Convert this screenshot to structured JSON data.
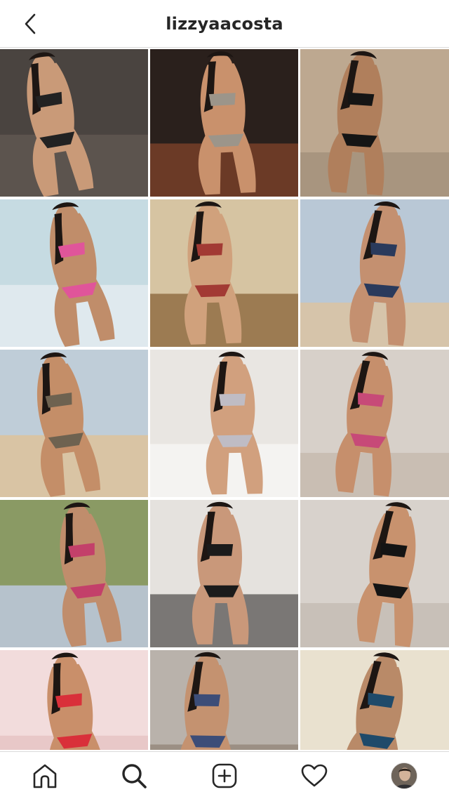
{
  "header": {
    "username": "lizzyaacosta",
    "back_icon": "chevron-left-icon"
  },
  "grid": {
    "columns": 3,
    "tiles": [
      {
        "name": "post-tile-1",
        "bg": "#4a4440",
        "ground": "#5c544e",
        "figure": "#c99a78",
        "accent": "#222222"
      },
      {
        "name": "post-tile-2",
        "bg": "#2a201c",
        "ground": "#6b3a26",
        "figure": "#c9916c",
        "accent": "#9c958a"
      },
      {
        "name": "post-tile-3",
        "bg": "#bda890",
        "ground": "#a8957f",
        "figure": "#b07f5c",
        "accent": "#151515"
      },
      {
        "name": "post-tile-4",
        "bg": "#c6dbe2",
        "ground": "#dfe9ee",
        "figure": "#c08d6a",
        "accent": "#e0559a"
      },
      {
        "name": "post-tile-5",
        "bg": "#d6c4a2",
        "ground": "#9c7b52",
        "figure": "#d0a17c",
        "accent": "#a23a34"
      },
      {
        "name": "post-tile-6",
        "bg": "#b9c8d6",
        "ground": "#d6c4aa",
        "figure": "#c49070",
        "accent": "#2a3a5c"
      },
      {
        "name": "post-tile-7",
        "bg": "#bfcdd8",
        "ground": "#d9c4a4",
        "figure": "#c48e68",
        "accent": "#6e6250"
      },
      {
        "name": "post-tile-8",
        "bg": "#e9e6e2",
        "ground": "#f4f3f1",
        "figure": "#d1a07e",
        "accent": "#bfbcc4"
      },
      {
        "name": "post-tile-9",
        "bg": "#d7d0c9",
        "ground": "#c9beb3",
        "figure": "#c68f6c",
        "accent": "#c74a78"
      },
      {
        "name": "post-tile-10",
        "bg": "#8a9a64",
        "ground": "#b6c2cc",
        "figure": "#c08d6c",
        "accent": "#c3406a"
      },
      {
        "name": "post-tile-11",
        "bg": "#e5e2de",
        "ground": "#7a7775",
        "figure": "#c9987a",
        "accent": "#1b1b1b"
      },
      {
        "name": "post-tile-12",
        "bg": "#d8d2cc",
        "ground": "#c8c0b8",
        "figure": "#c8926e",
        "accent": "#141414"
      },
      {
        "name": "post-tile-13",
        "bg": "#f2dcdc",
        "ground": "#e8c8c8",
        "figure": "#c98f6a",
        "accent": "#d9303a"
      },
      {
        "name": "post-tile-14",
        "bg": "#b9b2ab",
        "ground": "#9b8f84",
        "figure": "#c49270",
        "accent": "#3c4d78"
      },
      {
        "name": "post-tile-15",
        "bg": "#e9e1cf",
        "ground": "#d9cdb4",
        "figure": "#b98a68",
        "accent": "#1f4a6a"
      }
    ]
  },
  "tabbar": {
    "items": [
      {
        "name": "tab-home",
        "icon": "home-icon"
      },
      {
        "name": "tab-search",
        "icon": "search-icon"
      },
      {
        "name": "tab-new-post",
        "icon": "plus-square-icon"
      },
      {
        "name": "tab-activity",
        "icon": "heart-icon"
      },
      {
        "name": "tab-profile",
        "icon": "profile-avatar"
      }
    ]
  },
  "colors": {
    "text": "#262626",
    "divider": "#dbdbdb",
    "background": "#ffffff"
  }
}
